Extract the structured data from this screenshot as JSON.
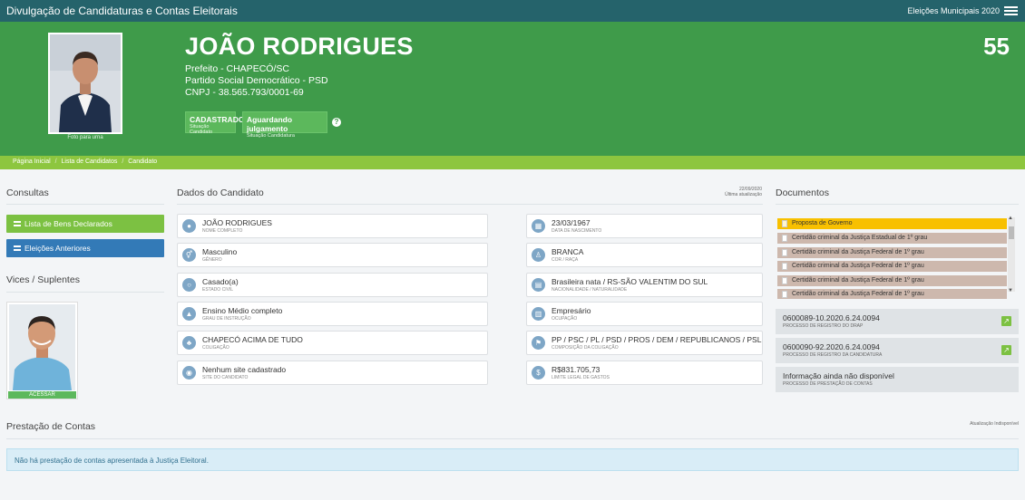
{
  "topbar": {
    "title": "Divulgação de Candidaturas e Contas Eleitorais",
    "election": "Eleições Municipais 2020",
    "menu_icon": "hamburger-icon"
  },
  "candidate": {
    "name": "JOÃO RODRIGUES",
    "office": "Prefeito - CHAPECÓ/SC",
    "party": "Partido Social Democrático - PSD",
    "cnpj": "CNPJ - 38.565.793/0001-69",
    "number": "55",
    "photo_caption": "Foto para urna",
    "status1_main": "CADASTRADO",
    "status1_sub": "Situação Candidato",
    "status2_main": "Aguardando julgamento",
    "status2_sub": "Situação Candidatura",
    "help_glyph": "?"
  },
  "breadcrumb": {
    "home": "Página Inicial",
    "list": "Lista de Candidatos",
    "current": "Candidato",
    "sep": "/"
  },
  "consultas": {
    "title": "Consultas",
    "bens_label": "Lista de Bens Declarados",
    "anteriores_label": "Eleições Anteriores"
  },
  "vices": {
    "title": "Vices / Suplentes",
    "access_label": "ACESSAR"
  },
  "dados": {
    "title": "Dados do Candidato",
    "updated_date": "22/09/2020",
    "updated_label": "Última atualização",
    "left": [
      {
        "icon": "user-icon",
        "value": "JOÃO RODRIGUES",
        "label": "Nome completo"
      },
      {
        "icon": "gender-icon",
        "value": "Masculino",
        "label": "Gênero"
      },
      {
        "icon": "ring-icon",
        "value": "Casado(a)",
        "label": "Estado civil"
      },
      {
        "icon": "graduation-cap-icon",
        "value": "Ensino Médio completo",
        "label": "Grau de instrução"
      },
      {
        "icon": "group-icon",
        "value": "CHAPECÓ ACIMA DE TUDO",
        "label": "Coligação"
      },
      {
        "icon": "globe-icon",
        "value": "Nenhum site cadastrado",
        "label": "Site do candidato"
      }
    ],
    "right": [
      {
        "icon": "calendar-icon",
        "value": "23/03/1967",
        "label": "Data de nascimento"
      },
      {
        "icon": "person-icon",
        "value": "BRANCA",
        "label": "Cor / Raça"
      },
      {
        "icon": "map-icon",
        "value": "Brasileira nata / RS-SÃO VALENTIM DO SUL",
        "label": "Nacionalidade / Naturalidade"
      },
      {
        "icon": "building-icon",
        "value": "Empresário",
        "label": "Ocupação"
      },
      {
        "icon": "flag-icon",
        "value": "PP / PSC / PL / PSD / PROS / DEM / REPUBLICANOS / PSL",
        "label": "Composição da coligação"
      },
      {
        "icon": "dollar-icon",
        "value": "R$831.705,73",
        "label": "Limite legal de gastos"
      }
    ]
  },
  "documentos": {
    "title": "Documentos",
    "items": [
      "Proposta de Governo",
      "Certidão criminal da Justiça Estadual de 1º grau",
      "Certidão criminal da Justiça Federal de 1º grau",
      "Certidão criminal da Justiça Federal de 1º grau",
      "Certidão criminal da Justiça Federal de 1º grau",
      "Certidão criminal da Justiça Federal de 1º grau"
    ],
    "processes": [
      {
        "value": "0600089-10.2020.6.24.0094",
        "label": "Processo de registro do DRAP"
      },
      {
        "value": "0600090-92.2020.6.24.0094",
        "label": "Processo de registro da candidatura"
      },
      {
        "value": "Informação ainda não disponível",
        "label": "Processo de prestação de contas"
      }
    ]
  },
  "prestacao": {
    "title": "Prestação de Contas",
    "updated": "Atualização Indisponível",
    "message": "Não há prestação de contas apresentada à Justiça Eleitoral."
  }
}
